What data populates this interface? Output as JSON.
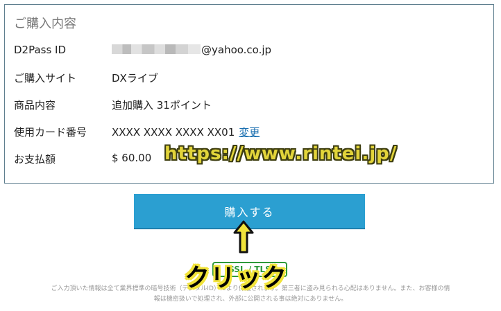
{
  "summary": {
    "title": "ご購入内容",
    "rows": [
      {
        "label": "D2Pass ID",
        "value": "@yahoo.co.jp"
      },
      {
        "label": "ご購入サイト",
        "value": "DXライブ"
      },
      {
        "label": "商品内容",
        "value": "追加購入 31ポイント"
      },
      {
        "label": "使用カード番号",
        "value": "XXXX XXXX XXXX XX01",
        "link": "変更"
      },
      {
        "label": "お支払額",
        "value": "$ 60.00"
      }
    ]
  },
  "watermark": "https://www.rintei.jp/",
  "purchase_button": "購入する",
  "ssl_badge": "SSL / TLS",
  "click_callout": "クリック",
  "footer_note": {
    "line1": "ご入力頂いた情報は全て業界標準の暗号技術（デジタルID）により保護されます。第三者に盗み見られる心配はありません。また、お客様の情",
    "line2": "報は機密扱いで処理され、外部に公開される事は絶対にありません。"
  },
  "colors": {
    "button": "#2b9fd1",
    "link": "#1a6fb0",
    "callout": "#f1e33a"
  },
  "icons": [
    "arrow-up-icon"
  ]
}
